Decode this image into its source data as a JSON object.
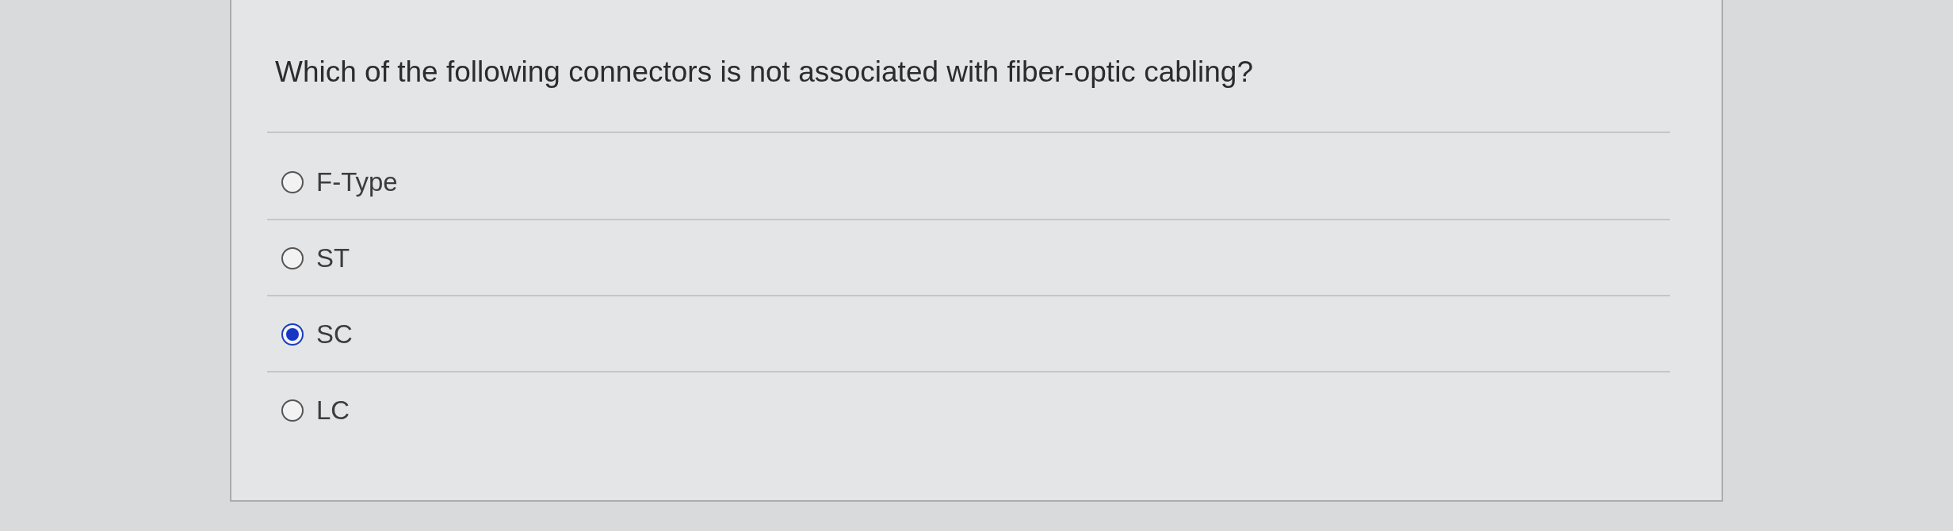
{
  "question": "Which of the following connectors is not associated with fiber-optic cabling?",
  "options": [
    {
      "label": "F-Type",
      "selected": false
    },
    {
      "label": "ST",
      "selected": false
    },
    {
      "label": "SC",
      "selected": true
    },
    {
      "label": "LC",
      "selected": false
    }
  ]
}
